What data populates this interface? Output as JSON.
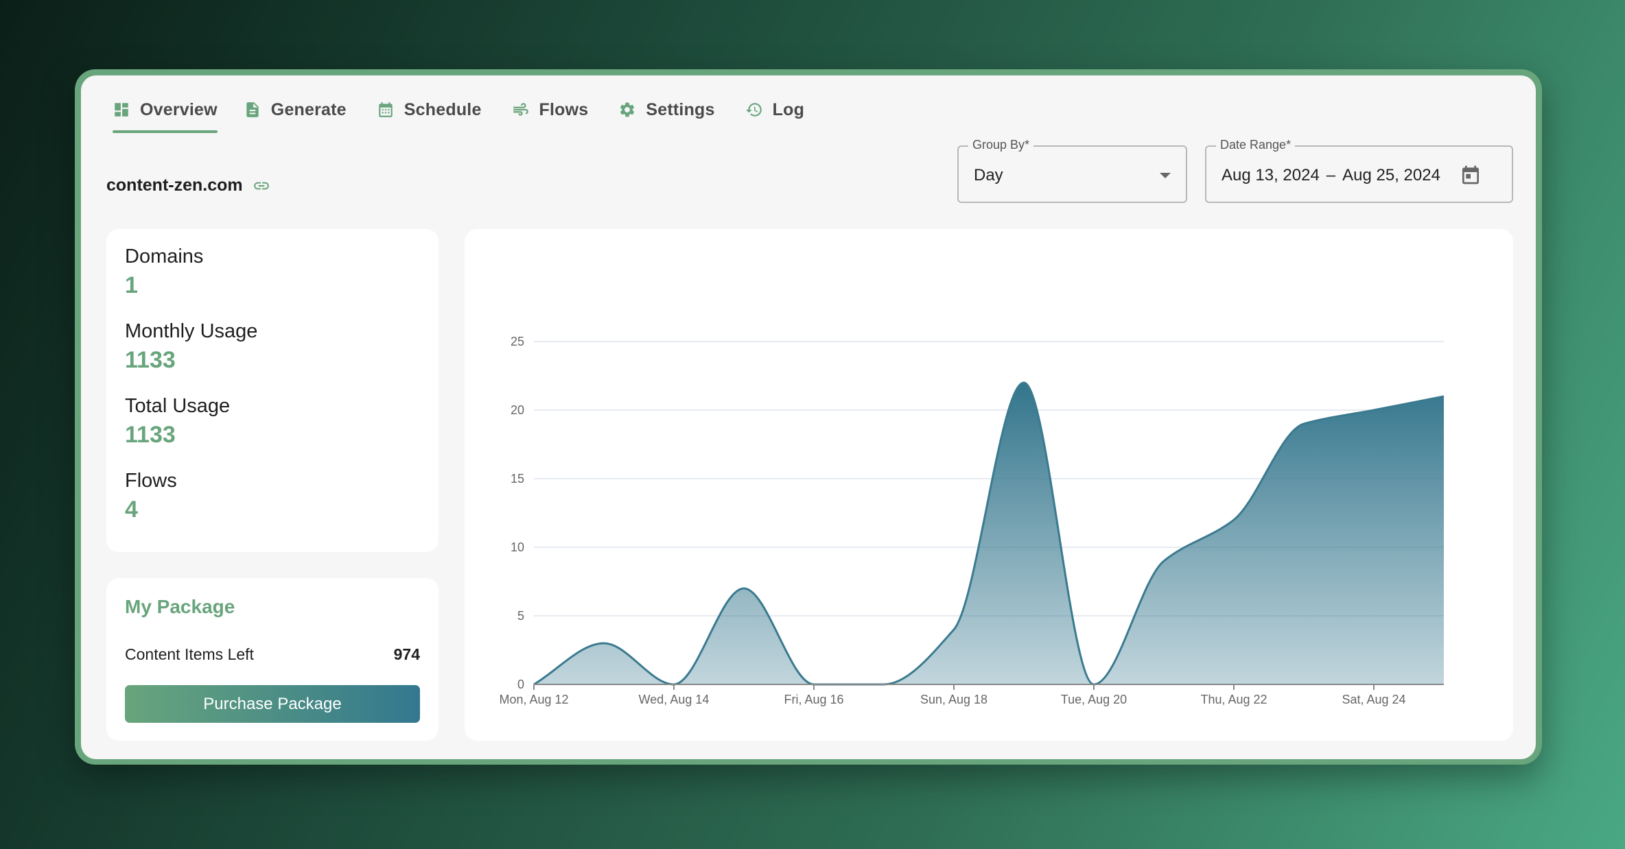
{
  "tabs": [
    {
      "label": "Overview",
      "icon": "dashboard-icon",
      "active": true
    },
    {
      "label": "Generate",
      "icon": "document-icon",
      "active": false
    },
    {
      "label": "Schedule",
      "icon": "calendar-icon",
      "active": false
    },
    {
      "label": "Flows",
      "icon": "wind-icon",
      "active": false
    },
    {
      "label": "Settings",
      "icon": "gear-icon",
      "active": false
    },
    {
      "label": "Log",
      "icon": "history-icon",
      "active": false
    }
  ],
  "domain": {
    "name": "content-zen.com",
    "icon": "link-icon"
  },
  "filters": {
    "group_by": {
      "label": "Group By*",
      "value": "Day"
    },
    "date_range": {
      "label": "Date Range*",
      "start": "Aug 13, 2024",
      "separator": "–",
      "end": "Aug 25, 2024",
      "icon": "calendar-icon"
    }
  },
  "stats": [
    {
      "label": "Domains",
      "value": "1"
    },
    {
      "label": "Monthly Usage",
      "value": "1133"
    },
    {
      "label": "Total Usage",
      "value": "1133"
    },
    {
      "label": "Flows",
      "value": "4"
    }
  ],
  "package": {
    "title": "My Package",
    "items_left_label": "Content Items Left",
    "items_left_value": "974",
    "purchase_label": "Purchase Package"
  },
  "colors": {
    "accent": "#68a57c",
    "chart_line": "#3a7a8f",
    "button_gradient_start": "#68a57c",
    "button_gradient_end": "#33788f"
  },
  "chart_data": {
    "type": "area",
    "title": "",
    "xlabel": "",
    "ylabel": "",
    "x": [
      "Aug 12",
      "Aug 13",
      "Aug 14",
      "Aug 15",
      "Aug 16",
      "Aug 17",
      "Aug 18",
      "Aug 19",
      "Aug 20",
      "Aug 21",
      "Aug 22",
      "Aug 23",
      "Aug 24",
      "Aug 25"
    ],
    "values": [
      0,
      3,
      0,
      7,
      0,
      0,
      4,
      22,
      0,
      9,
      12,
      19,
      20,
      21
    ],
    "x_tick_labels": [
      "Mon, Aug 12",
      "Wed, Aug 14",
      "Fri, Aug 16",
      "Sun, Aug 18",
      "Tue, Aug 20",
      "Thu, Aug 22",
      "Sat, Aug 24"
    ],
    "x_tick_indices": [
      0,
      2,
      4,
      6,
      8,
      10,
      12
    ],
    "y_ticks": [
      0,
      5,
      10,
      15,
      20,
      25
    ],
    "ylim": [
      0,
      25
    ],
    "grid": true,
    "legend": "none",
    "curve": "smooth"
  }
}
